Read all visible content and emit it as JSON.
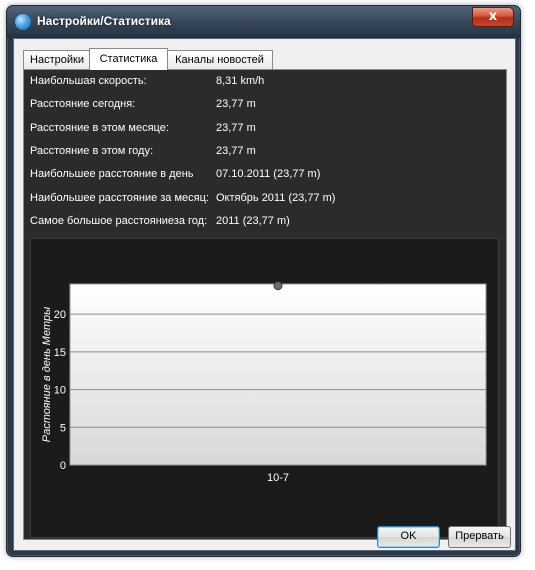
{
  "window": {
    "title": "Настройки/Статистика",
    "close_label": "x"
  },
  "tabs": [
    {
      "label": "Настройки",
      "active": false
    },
    {
      "label": "Статистика",
      "active": true
    },
    {
      "label": "Каналы новостей",
      "active": false
    }
  ],
  "stats": [
    {
      "label": "Наибольшая скорость:",
      "value": "8,31 km/h"
    },
    {
      "label": "Расстояние сегодня:",
      "value": "23,77 m"
    },
    {
      "label": "Расстояние в этом месяце:",
      "value": "23,77 m"
    },
    {
      "label": "Расстояние в этом году:",
      "value": "23,77 m"
    },
    {
      "label": "Наибольшее расстояние в день",
      "value": "07.10.2011 (23,77 m)"
    },
    {
      "label": "Наибольшее расстояние за месяц:",
      "value": "Октябрь 2011 (23,77 m)"
    },
    {
      "label": "Самое большое расстояниеза год:",
      "value": "2011 (23,77 m)"
    }
  ],
  "chart_data": {
    "type": "scatter",
    "categories": [
      "10-7"
    ],
    "series": [
      {
        "values": [
          23.77
        ]
      }
    ],
    "ylabel": "Растояние в день Метры",
    "xlabel": "",
    "ylim": [
      0,
      24
    ],
    "yticks": [
      0,
      5,
      10,
      15,
      20
    ],
    "grid": true
  },
  "buttons": {
    "ok": "OK",
    "cancel": "Прервать"
  },
  "colors": {
    "panel_bg": "#2b2b2b",
    "point": "#6b6e74"
  }
}
